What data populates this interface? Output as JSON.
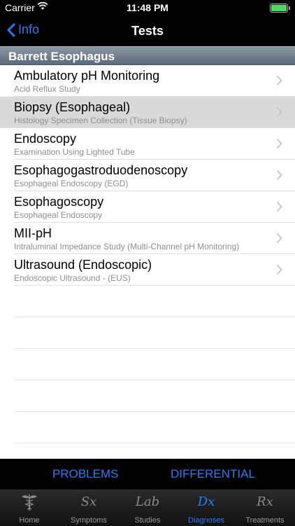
{
  "status": {
    "carrier": "Carrier",
    "time": "11:48 PM"
  },
  "nav": {
    "back_label": "Info",
    "title": "Tests"
  },
  "section": {
    "title": "Barrett Esophagus"
  },
  "rows": [
    {
      "title": "Ambulatory pH Monitoring",
      "subtitle": "Acid Reflux Study"
    },
    {
      "title": "Biopsy (Esophageal)",
      "subtitle": "Histology Specimen Collection (Tissue Biopsy)"
    },
    {
      "title": "Endoscopy",
      "subtitle": "Examination Using Lighted Tube"
    },
    {
      "title": "Esophagogastroduodenoscopy",
      "subtitle": "Esophageal Endoscopy (EGD)"
    },
    {
      "title": "Esophagoscopy",
      "subtitle": "Esophageal Endoscopy"
    },
    {
      "title": "MII-pH",
      "subtitle": "Intraluminal Impedance Study (Multi-Channel pH Monitoring)"
    },
    {
      "title": "Ultrasound (Endoscopic)",
      "subtitle": "Endoscopic Ultrasound - (EUS)"
    }
  ],
  "segments": {
    "problems": "PROBLEMS",
    "differential": "DIFFERENTIAL"
  },
  "tabs": [
    {
      "label": "Home",
      "glyph": ""
    },
    {
      "label": "Symptoms",
      "glyph": "Sx"
    },
    {
      "label": "Studies",
      "glyph": "Lab"
    },
    {
      "label": "Diagnoses",
      "glyph": "Dx"
    },
    {
      "label": "Treatments",
      "glyph": "Rx"
    }
  ],
  "colors": {
    "accent": "#2a7cf6",
    "selected_row": "#d9d9d9",
    "battery": "#4cd964"
  },
  "icons": {
    "back": "chevron-left-icon",
    "row_disclosure": "chevron-right-icon",
    "home": "caduceus-icon",
    "wifi": "wifi-icon",
    "battery": "battery-icon"
  }
}
